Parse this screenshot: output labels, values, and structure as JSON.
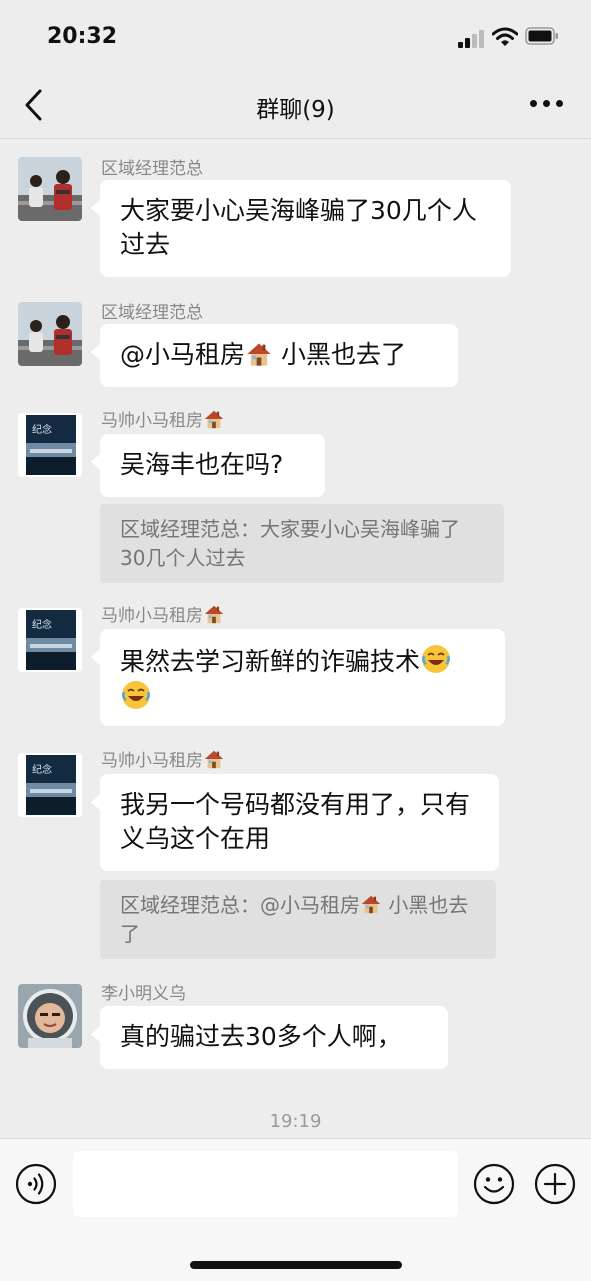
{
  "status_bar": {
    "time": "20:32"
  },
  "header": {
    "title": "群聊(9)"
  },
  "messages": [
    {
      "sender": "区域经理范总",
      "text": "大家要小心吴海峰骗了30几个人过去"
    },
    {
      "sender": "区域经理范总",
      "text_before": "@小马租房",
      "text_after": " 小黑也去了"
    },
    {
      "sender": "马帅小马租房",
      "text": "吴海丰也在吗?",
      "quote": "区域经理范总：大家要小心吴海峰骗了30几个人过去"
    },
    {
      "sender": "马帅小马租房",
      "text": "果然去学习新鲜的诈骗技术"
    },
    {
      "sender": "马帅小马租房",
      "text": "我另一个号码都没有用了，只有义乌这个在用",
      "quote_before": "区域经理范总：@小马租房",
      "quote_after": " 小黑也去了"
    },
    {
      "sender": "李小明义乌",
      "text": "真的骗过去30多个人啊，"
    }
  ],
  "timestamp": "19:19",
  "colors": {
    "background": "#ededed",
    "bubble": "#ffffff",
    "quote": "#e0e0e0"
  }
}
